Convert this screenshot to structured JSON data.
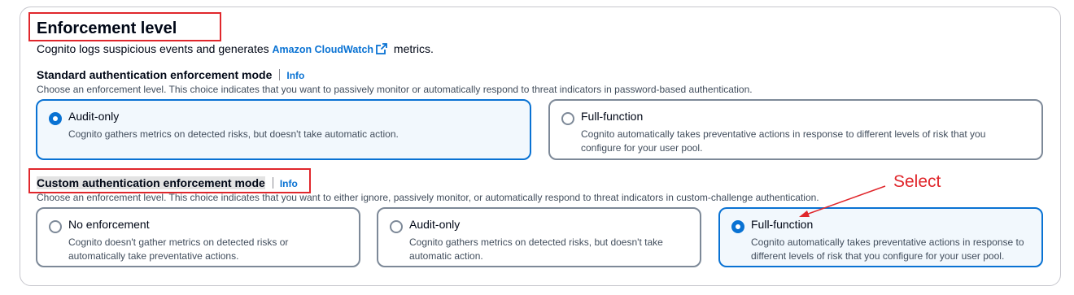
{
  "title": "Enforcement level",
  "description": {
    "before": "Cognito logs suspicious events and generates ",
    "link": "Amazon CloudWatch",
    "after": " metrics."
  },
  "standard": {
    "label": "Standard authentication enforcement mode",
    "info": "Info",
    "hint": "Choose an enforcement level. This choice indicates that you want to passively monitor or automatically respond to threat indicators in password-based authentication.",
    "options": [
      {
        "title": "Audit-only",
        "desc": "Cognito gathers metrics on detected risks, but doesn't take automatic action.",
        "selected": true
      },
      {
        "title": "Full-function",
        "desc": "Cognito automatically takes preventative actions in response to different levels of risk that you configure for your user pool.",
        "selected": false
      }
    ]
  },
  "custom": {
    "label": "Custom authentication enforcement mode",
    "info": "Info",
    "hint": "Choose an enforcement level. This choice indicates that you want to either ignore, passively monitor, or automatically respond to threat indicators in custom-challenge authentication.",
    "options": [
      {
        "title": "No enforcement",
        "desc": "Cognito doesn't gather metrics on detected risks or automatically take preventative actions.",
        "selected": false
      },
      {
        "title": "Audit-only",
        "desc": "Cognito gathers metrics on detected risks, but doesn't take automatic action.",
        "selected": false
      },
      {
        "title": "Full-function",
        "desc": "Cognito automatically takes preventative actions in response to different levels of risk that you configure for your user pool.",
        "selected": true
      }
    ]
  },
  "annotation": {
    "text": "Select",
    "color": "#e0272c"
  },
  "colors": {
    "accent": "#0972d3",
    "annotation": "#e0272c",
    "text": "#000716"
  },
  "icons": {
    "external_link": "external-link-icon"
  }
}
